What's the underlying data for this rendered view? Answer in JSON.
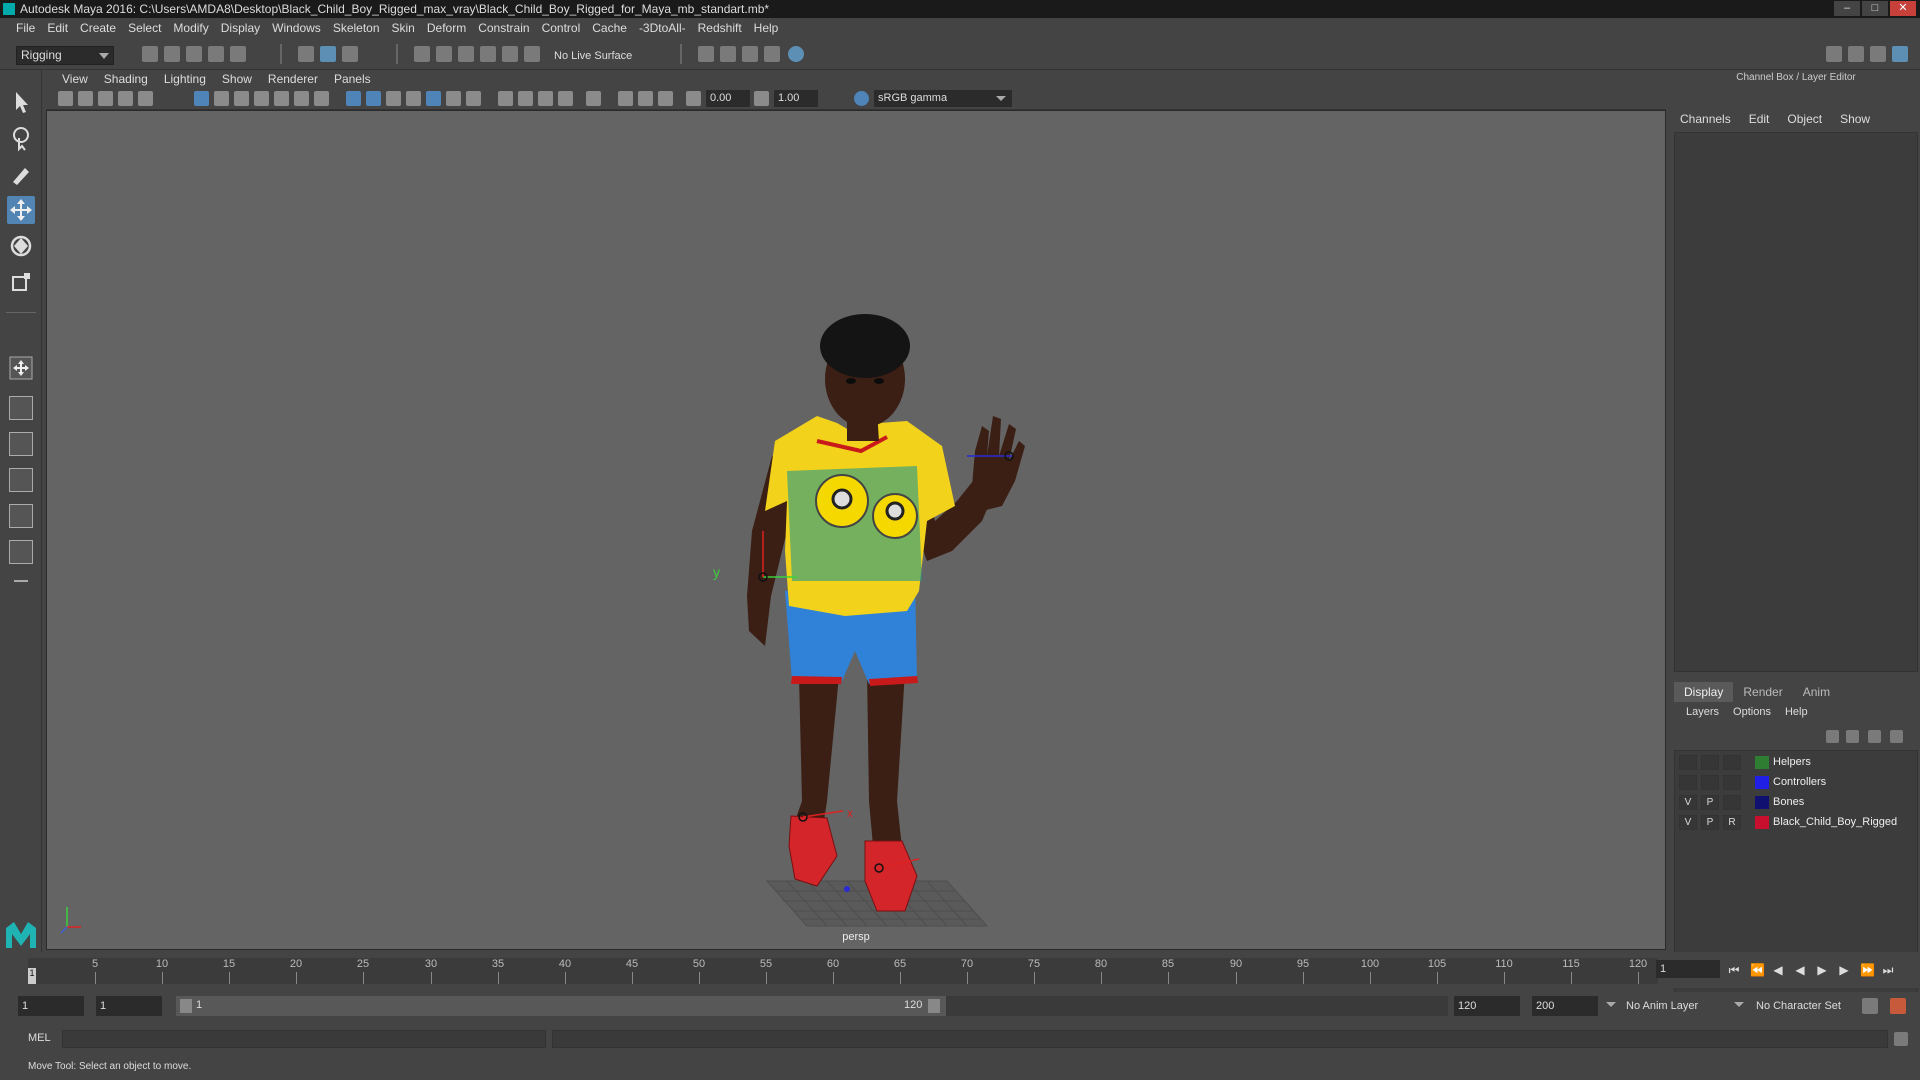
{
  "window": {
    "title": "Autodesk Maya 2016: C:\\Users\\AMDA8\\Desktop\\Black_Child_Boy_Rigged_max_vray\\Black_Child_Boy_Rigged_for_Maya_mb_standart.mb*",
    "min": "–",
    "max": "□",
    "close": "✕"
  },
  "menubar": [
    "File",
    "Edit",
    "Create",
    "Select",
    "Modify",
    "Display",
    "Windows",
    "Skeleton",
    "Skin",
    "Deform",
    "Constrain",
    "Control",
    "Cache",
    "-3DtoAll-",
    "Redshift",
    "Help"
  ],
  "status": {
    "mode": "Rigging",
    "live_surface": "No Live Surface"
  },
  "panel_menu": [
    "View",
    "Shading",
    "Lighting",
    "Show",
    "Renderer",
    "Panels"
  ],
  "panel_toolbar": {
    "exposure": "0.00",
    "gamma": "1.00",
    "color_space": "sRGB gamma"
  },
  "viewport": {
    "camera": "persp",
    "axis_y": "y",
    "axis_x": "x",
    "colors": {
      "skin": "#3b1f14",
      "shirt": "#f2d21b",
      "shorts": "#2f82d8",
      "trim": "#c81a1a",
      "shoe": "#d4262a"
    }
  },
  "channel_box": {
    "title": "Channel Box / Layer Editor",
    "menu": [
      "Channels",
      "Edit",
      "Object",
      "Show"
    ]
  },
  "layer_editor": {
    "tabs": [
      "Display",
      "Render",
      "Anim"
    ],
    "menu": [
      "Layers",
      "Options",
      "Help"
    ],
    "layers": [
      {
        "v": "",
        "p": "",
        "r": "",
        "color": "#2e7d32",
        "name": "Helpers"
      },
      {
        "v": "",
        "p": "",
        "r": "",
        "color": "#1f1fe6",
        "name": "Controllers"
      },
      {
        "v": "V",
        "p": "P",
        "r": "",
        "color": "#101070",
        "name": "Bones"
      },
      {
        "v": "V",
        "p": "P",
        "r": "R",
        "color": "#c8102e",
        "name": "Black_Child_Boy_Rigged"
      }
    ]
  },
  "timeline": {
    "ticks": [
      "5",
      "10",
      "15",
      "20",
      "25",
      "30",
      "35",
      "40",
      "45",
      "50",
      "55",
      "60",
      "65",
      "70",
      "75",
      "80",
      "85",
      "90",
      "95",
      "100",
      "105",
      "110",
      "115",
      "120"
    ],
    "current_marker": "1",
    "current_frame": "1"
  },
  "range": {
    "start": "1",
    "playback_start": "1",
    "slider_start": "1",
    "slider_end": "120",
    "playback_end": "120",
    "end": "200",
    "anim_layer": "No Anim Layer",
    "char_set": "No Character Set"
  },
  "command": {
    "lang": "MEL"
  },
  "help": "Move Tool: Select an object to move."
}
